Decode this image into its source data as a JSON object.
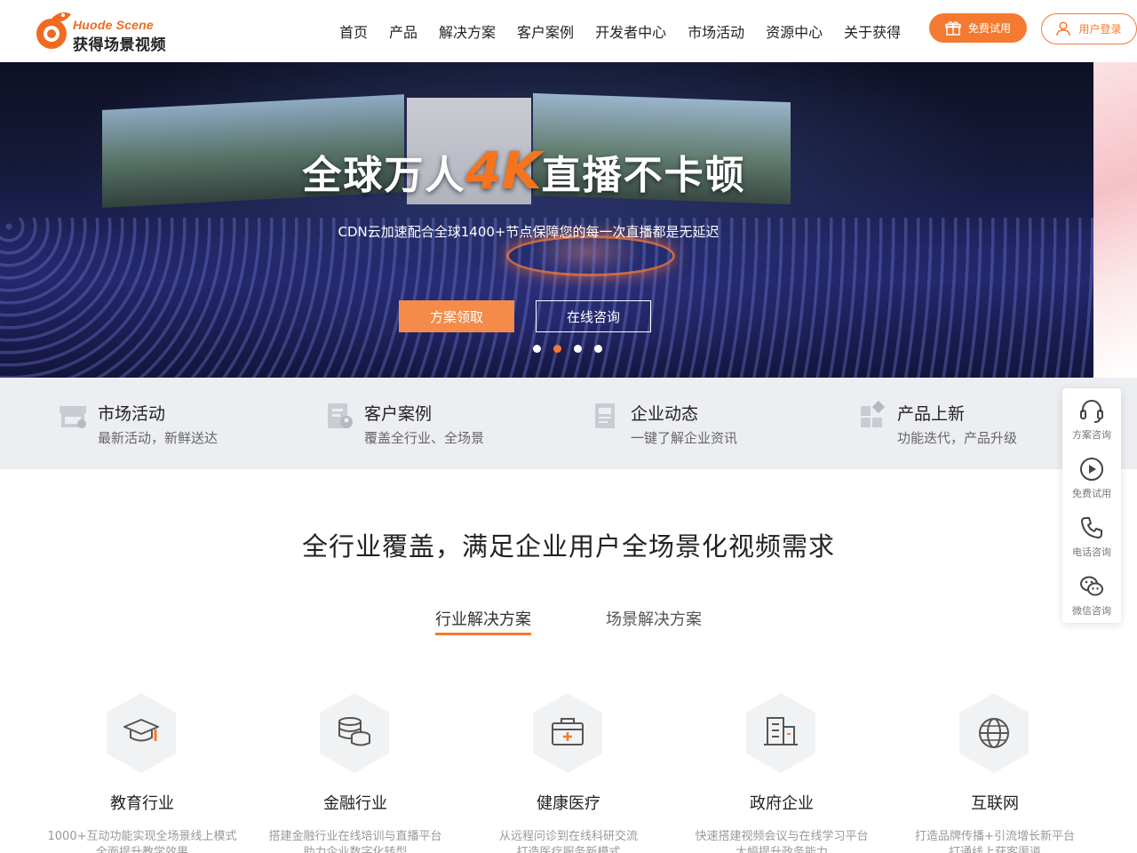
{
  "brand": {
    "name_en": "Huode Scene",
    "name_cn": "获得场景视频",
    "accent": "#f47a31"
  },
  "nav": {
    "items": [
      "首页",
      "产品",
      "解决方案",
      "客户案例",
      "开发者中心",
      "市场活动",
      "资源中心",
      "关于获得"
    ]
  },
  "header": {
    "trial_label": "免费试用",
    "login_label": "用户登录"
  },
  "hero": {
    "title_before": "全球万人",
    "title_accent": "4K",
    "title_after": "直播不卡顿",
    "subtitle": "CDN云加速配合全球1400+节点保障您的每一次直播都是无延迟",
    "btn_primary": "方案领取",
    "btn_secondary": "在线咨询",
    "slide_count": 4,
    "active_slide": 2
  },
  "quick_links": [
    {
      "title": "市场活动",
      "sub": "最新活动，新鲜送达",
      "icon": "store-icon"
    },
    {
      "title": "客户案例",
      "sub": "覆盖全行业、全场景",
      "icon": "case-icon"
    },
    {
      "title": "企业动态",
      "sub": "一键了解企业资讯",
      "icon": "news-icon"
    },
    {
      "title": "产品上新",
      "sub": "功能迭代，产品升级",
      "icon": "apps-icon"
    }
  ],
  "sidebar": {
    "items": [
      "方案咨询",
      "免费试用",
      "电话咨询",
      "微信咨询"
    ]
  },
  "section": {
    "title": "全行业覆盖，满足企业用户全场景化视频需求",
    "tabs": [
      "行业解决方案",
      "场景解决方案"
    ],
    "active_tab": 0
  },
  "industries": [
    {
      "name": "教育行业",
      "line1": "1000+互动功能实现全场景线上模式",
      "line2": "全面提升教学效果",
      "icon": "graduation-cap-icon"
    },
    {
      "name": "金融行业",
      "line1": "搭建金融行业在线培训与直播平台",
      "line2": "助力企业数字化转型",
      "icon": "coins-icon"
    },
    {
      "name": "健康医疗",
      "line1": "从远程问诊到在线科研交流",
      "line2": "打造医疗服务新模式",
      "icon": "medical-kit-icon"
    },
    {
      "name": "政府企业",
      "line1": "快速搭建视频会议与在线学习平台",
      "line2": "大幅提升政务能力",
      "icon": "building-icon"
    },
    {
      "name": "互联网",
      "line1": "打造品牌传播+引流增长新平台",
      "line2": "打通线上获客渠道",
      "icon": "globe-icon"
    }
  ]
}
